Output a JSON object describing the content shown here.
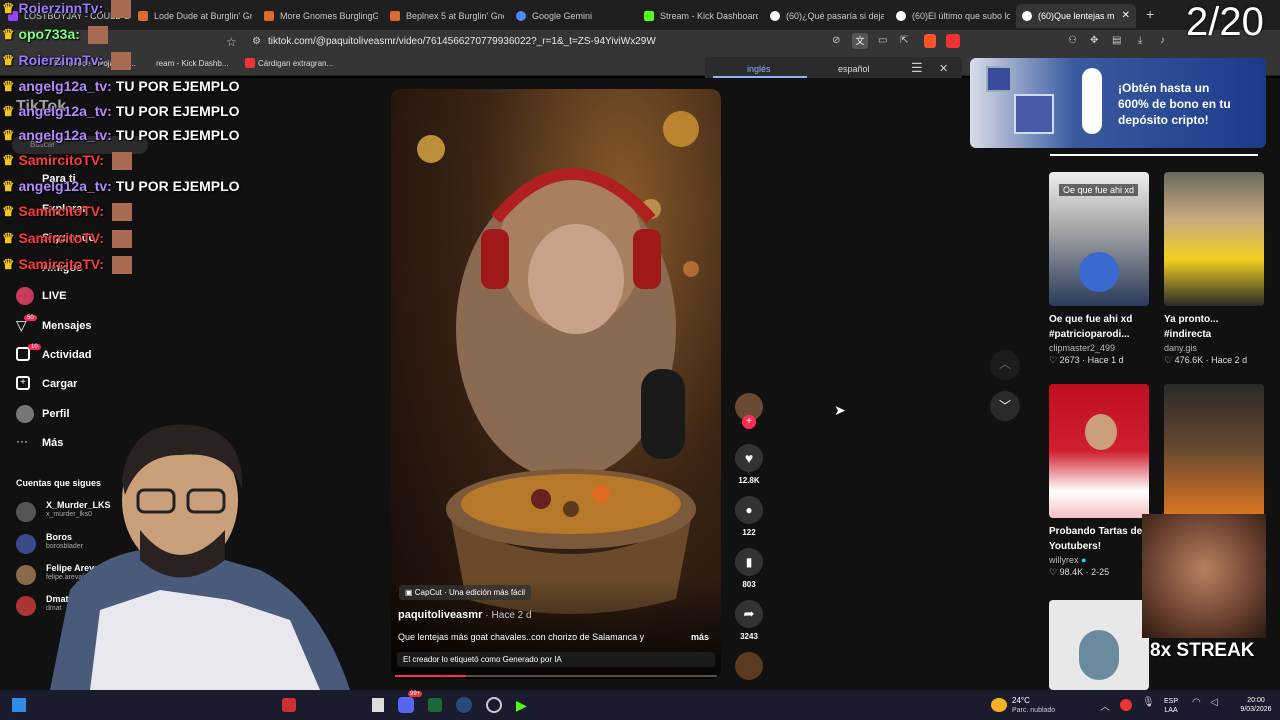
{
  "tabs": [
    {
      "label": "LOSTBOYJAY - COULD BE",
      "icon": "twitch-icon",
      "color": "#9146ff"
    },
    {
      "label": "Lode Dude at Burglin' Gn",
      "icon": "page-icon",
      "color": "#e06c2c"
    },
    {
      "label": "More Gnomes BurglingGn",
      "icon": "page-icon",
      "color": "#e06c2c"
    },
    {
      "label": "Beplnex 5 at Burglin' Gnom",
      "icon": "page-icon",
      "color": "#e06c2c"
    },
    {
      "label": "Google Gemini",
      "icon": "gemini-icon",
      "color": "#4b8bf5"
    },
    {
      "label": "Stream - Kick Dashboard",
      "icon": "kick-icon",
      "color": "#53fc18"
    },
    {
      "label": "(60)¿Qué pasaría si dejara",
      "icon": "tiktok-icon",
      "color": "#ffffff"
    },
    {
      "label": "(60)El último que subo lo",
      "icon": "tiktok-icon",
      "color": "#ffffff"
    },
    {
      "label": "(60)Que lentejas m",
      "icon": "tiktok-icon",
      "color": "#ffffff"
    }
  ],
  "counter": "2/20",
  "url": "tiktok.com/@paquitoliveasmr/video/7614566270779936022?_r=1&_t=ZS-94YiviWx29W",
  "bookmarks": {
    "item1": "Pertenece · Hojas de...",
    "item2": "ream - Kick Dashb...",
    "item3": "Cárdigan extragran..."
  },
  "translate": {
    "lang1": "inglés",
    "lang2": "español"
  },
  "chat": [
    {
      "user": "RoierzinnTv:",
      "msg": "",
      "color": "#9b7cff"
    },
    {
      "user": "opo733a:",
      "msg": "",
      "color": "#7fff7f"
    },
    {
      "user": "RoierzinnTv:",
      "msg": "",
      "color": "#9b7cff"
    },
    {
      "user": "angelg12a_tv:",
      "msg": "TU POR EJEMPLO",
      "color": "#b689ff"
    },
    {
      "user": "angelg12a_tv:",
      "msg": "TU POR EJEMPLO",
      "color": "#b689ff"
    },
    {
      "user": "angelg12a_tv:",
      "msg": "TU POR EJEMPLO",
      "color": "#b689ff"
    },
    {
      "user": "SamircitoTV:",
      "msg": "",
      "color": "#ff3b3b"
    },
    {
      "user": "angelg12a_tv:",
      "msg": "TU POR EJEMPLO",
      "color": "#b689ff"
    },
    {
      "user": "SamircitoTV:",
      "msg": "",
      "color": "#ff3b3b"
    },
    {
      "user": "SamircitoTV:",
      "msg": "",
      "color": "#ff3b3b"
    },
    {
      "user": "SamircitoTV:",
      "msg": "",
      "color": "#ff3b3b"
    }
  ],
  "sidebar": {
    "logo": "TikTok",
    "search_placeholder": "Buscar",
    "nav": [
      {
        "label": "Para ti"
      },
      {
        "label": "Explorar"
      },
      {
        "label": "Siguiendo"
      },
      {
        "label": "Amigos"
      },
      {
        "label": "LIVE"
      },
      {
        "label": "Mensajes",
        "badge": "50"
      },
      {
        "label": "Actividad",
        "badge": "10"
      },
      {
        "label": "Cargar"
      },
      {
        "label": "Perfil"
      },
      {
        "label": "Más"
      }
    ],
    "following_title": "Cuentas que sigues",
    "accounts": [
      {
        "name": "X_Murder_LKS",
        "handle": "x_murder_lks0"
      },
      {
        "name": "Boros",
        "handle": "borosblader"
      },
      {
        "name": "Felipe Arevalo",
        "handle": "felipe.arevalo0"
      },
      {
        "name": "Dmatri",
        "handle": "dmat"
      }
    ]
  },
  "video": {
    "capcut": "CapCut · Una edición más fácil",
    "author": "paquitoliveasmr",
    "time": "· Hace 2 d",
    "caption": "Que lentejas más goat chavales..con chorizo de Salamanca y",
    "more": "más",
    "ai_label": "El creador lo etiquetó como Generado por IA",
    "progress": 0.22
  },
  "actions": {
    "likes": "12.8K",
    "comments": "122",
    "saves": "803",
    "shares": "3243"
  },
  "ad": {
    "text": "¡Obtén hasta un 600% de bono en tu depósito cripto!"
  },
  "cards": [
    {
      "overlay": "Oe que fue ahi xd",
      "title": "Oe que fue ahi xd #patricioparodi...",
      "author": "clipmaster2_499",
      "stats": "♡ 2673 · Hace 1 d"
    },
    {
      "overlay": "",
      "title": "Ya pronto... #indirecta",
      "author": "dany.gis",
      "stats": "♡ 476.6K · Hace 2 d"
    },
    {
      "overlay": "",
      "title": "Probando Tartas de Youtubers!",
      "author": "willyrex",
      "stats": "♡ 98.4K · 2-25"
    },
    {
      "overlay": "",
      "title": "",
      "author": "",
      "stats": ""
    }
  ],
  "streak": "8x STREAK",
  "taskbar": {
    "temp": "24°C",
    "weather": "Parc. nublado",
    "lang1": "ESP",
    "lang2": "LAA",
    "time": "20:00",
    "date": "9/03/2026",
    "discord_badge": "99+"
  }
}
